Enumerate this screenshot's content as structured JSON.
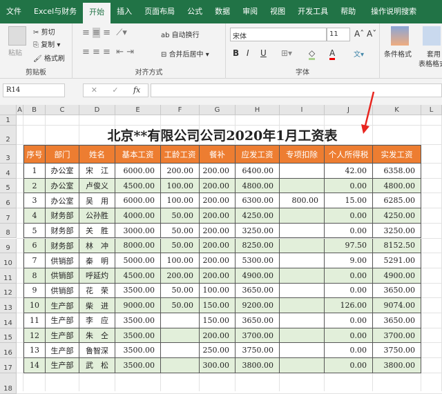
{
  "tabs": [
    "文件",
    "Excel与财务",
    "开始",
    "插入",
    "页面布局",
    "公式",
    "数据",
    "审阅",
    "视图",
    "开发工具",
    "帮助",
    "操作说明搜索"
  ],
  "ribbon": {
    "paste": "粘贴",
    "cut": "剪切",
    "copy": "复制",
    "format_painter": "格式刷",
    "clipboard": "剪贴板",
    "wrap": "自动换行",
    "merge": "合并后居中",
    "alignment": "对齐方式",
    "font_name": "宋体",
    "font_size": "11",
    "bold": "B",
    "italic": "I",
    "underline": "U",
    "font_color": "A",
    "font_group": "字体",
    "cond_format": "条件格式",
    "table_format_1": "套用",
    "table_format_2": "表格格式"
  },
  "formula_bar": {
    "name_box": "R14",
    "fx": "fx",
    "cancel": "✕",
    "enter": "✓",
    "value": ""
  },
  "columns": [
    "A",
    "B",
    "C",
    "D",
    "E",
    "F",
    "G",
    "H",
    "I",
    "J",
    "K",
    "L"
  ],
  "rows": [
    "1",
    "2",
    "3",
    "4",
    "5",
    "6",
    "7",
    "8",
    "9",
    "10",
    "11",
    "12",
    "13",
    "14",
    "15",
    "16",
    "17",
    "18"
  ],
  "sheet": {
    "title": "北京**有限公司公司2020年1月工资表",
    "headers": [
      "序号",
      "部门",
      "姓名",
      "基本工资",
      "工龄工资",
      "餐补",
      "应发工资",
      "专项扣除",
      "个人所得税",
      "实发工资"
    ],
    "records": [
      [
        "1",
        "办公室",
        "宋　江",
        "6000.00",
        "200.00",
        "200.00",
        "6400.00",
        "",
        "42.00",
        "6358.00"
      ],
      [
        "2",
        "办公室",
        "卢俊义",
        "4500.00",
        "100.00",
        "200.00",
        "4800.00",
        "",
        "0.00",
        "4800.00"
      ],
      [
        "3",
        "办公室",
        "吴　用",
        "6000.00",
        "100.00",
        "200.00",
        "6300.00",
        "800.00",
        "15.00",
        "6285.00"
      ],
      [
        "4",
        "财务部",
        "公孙胜",
        "4000.00",
        "50.00",
        "200.00",
        "4250.00",
        "",
        "0.00",
        "4250.00"
      ],
      [
        "5",
        "财务部",
        "关　胜",
        "3000.00",
        "50.00",
        "200.00",
        "3250.00",
        "",
        "0.00",
        "3250.00"
      ],
      [
        "6",
        "财务部",
        "林　冲",
        "8000.00",
        "50.00",
        "200.00",
        "8250.00",
        "",
        "97.50",
        "8152.50"
      ],
      [
        "7",
        "供销部",
        "秦　明",
        "5000.00",
        "100.00",
        "200.00",
        "5300.00",
        "",
        "9.00",
        "5291.00"
      ],
      [
        "8",
        "供销部",
        "呼延灼",
        "4500.00",
        "200.00",
        "200.00",
        "4900.00",
        "",
        "0.00",
        "4900.00"
      ],
      [
        "9",
        "供销部",
        "花　荣",
        "3500.00",
        "50.00",
        "100.00",
        "3650.00",
        "",
        "0.00",
        "3650.00"
      ],
      [
        "10",
        "生产部",
        "柴　进",
        "9000.00",
        "50.00",
        "150.00",
        "9200.00",
        "",
        "126.00",
        "9074.00"
      ],
      [
        "11",
        "生产部",
        "李　应",
        "3500.00",
        "",
        "150.00",
        "3650.00",
        "",
        "0.00",
        "3650.00"
      ],
      [
        "12",
        "生产部",
        "朱　仝",
        "3500.00",
        "",
        "200.00",
        "3700.00",
        "",
        "0.00",
        "3700.00"
      ],
      [
        "13",
        "生产部",
        "鲁智深",
        "3500.00",
        "",
        "250.00",
        "3750.00",
        "",
        "0.00",
        "3750.00"
      ],
      [
        "14",
        "生产部",
        "武　松",
        "3500.00",
        "",
        "300.00",
        "3800.00",
        "",
        "0.00",
        "3800.00"
      ]
    ]
  },
  "colors": {
    "green": "#217346",
    "header": "#ed7d31",
    "band": "#e2efda",
    "arrow": "#e8251f"
  }
}
